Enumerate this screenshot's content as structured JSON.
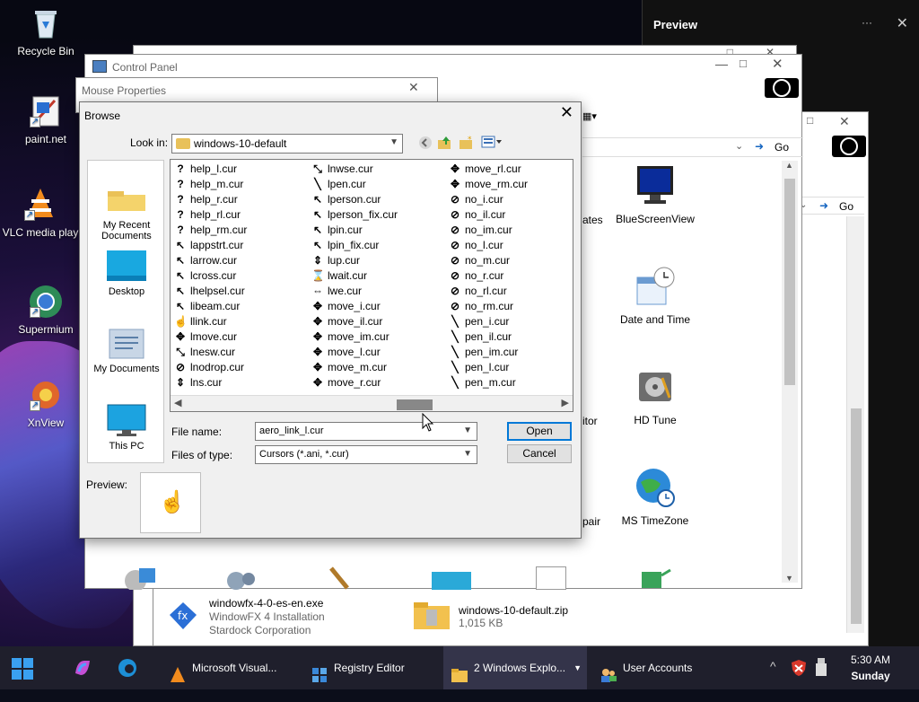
{
  "desktop": {
    "icons": [
      {
        "label": "Recycle Bin",
        "icon": "recycle-bin-icon"
      },
      {
        "label": "paint.net",
        "icon": "paintnet-icon"
      },
      {
        "label": "VLC media play",
        "icon": "vlc-icon"
      },
      {
        "label": "Supermium",
        "icon": "supermium-icon"
      },
      {
        "label": "XnView",
        "icon": "xnview-icon"
      }
    ]
  },
  "preview_pane": {
    "title": "Preview"
  },
  "control_panel": {
    "title": "Control Panel",
    "go_label": "Go",
    "items": [
      {
        "label": "BlueScreenView",
        "icon": "monitor-icon"
      },
      {
        "label": "Date and Time",
        "icon": "calendar-clock-icon"
      },
      {
        "label": "HD Tune",
        "icon": "hard-drive-icon"
      },
      {
        "label": "MS TimeZone",
        "icon": "globe-clock-icon"
      }
    ],
    "partial_labels": [
      "ates",
      "itor",
      "pair"
    ]
  },
  "explorer_back": {
    "go_label": "Go",
    "files": [
      {
        "name": "windowfx-4-0-es-en.exe",
        "line2": "WindowFX 4 Installation",
        "line3": "Stardock Corporation",
        "icon": "fx-installer-icon"
      },
      {
        "name": "windows-10-default.zip",
        "line2": "1,015 KB",
        "icon": "zip-folder-icon"
      }
    ]
  },
  "mouse_properties": {
    "title": "Mouse Properties"
  },
  "browse": {
    "title": "Browse",
    "look_in_label": "Look in:",
    "look_in_value": "windows-10-default",
    "places": [
      {
        "label": "My Recent Documents",
        "icon": "recent-documents-icon"
      },
      {
        "label": "Desktop",
        "icon": "desktop-icon"
      },
      {
        "label": "My Documents",
        "icon": "my-documents-icon"
      },
      {
        "label": "This PC",
        "icon": "this-pc-icon"
      }
    ],
    "columns": [
      [
        "help_l.cur",
        "help_m.cur",
        "help_r.cur",
        "help_rl.cur",
        "help_rm.cur",
        "lappstrt.cur",
        "larrow.cur",
        "lcross.cur",
        "lhelpsel.cur",
        "libeam.cur",
        "llink.cur",
        "lmove.cur",
        "lnesw.cur",
        "lnodrop.cur",
        "lns.cur"
      ],
      [
        "lnwse.cur",
        "lpen.cur",
        "lperson.cur",
        "lperson_fix.cur",
        "lpin.cur",
        "lpin_fix.cur",
        "lup.cur",
        "lwait.cur",
        "lwe.cur",
        "move_i.cur",
        "move_il.cur",
        "move_im.cur",
        "move_l.cur",
        "move_m.cur",
        "move_r.cur"
      ],
      [
        "move_rl.cur",
        "move_rm.cur",
        "no_i.cur",
        "no_il.cur",
        "no_im.cur",
        "no_l.cur",
        "no_m.cur",
        "no_r.cur",
        "no_rl.cur",
        "no_rm.cur",
        "pen_i.cur",
        "pen_il.cur",
        "pen_im.cur",
        "pen_l.cur",
        "pen_m.cur"
      ]
    ],
    "file_name_label": "File name:",
    "file_name_value": "aero_link_l.cur",
    "files_of_type_label": "Files of type:",
    "files_of_type_value": "Cursors (*.ani, *.cur)",
    "open_label": "Open",
    "cancel_label": "Cancel",
    "preview_label": "Preview:"
  },
  "taskbar": {
    "tasks": [
      {
        "label": "Microsoft Visual...",
        "icon": "vlc-icon"
      },
      {
        "label": "Registry Editor",
        "icon": "registry-editor-icon"
      },
      {
        "label": "2 Windows Explo...",
        "icon": "folder-icon"
      },
      {
        "label": "User Accounts",
        "icon": "user-accounts-icon"
      }
    ],
    "time": "5:30 AM",
    "day": "Sunday"
  }
}
